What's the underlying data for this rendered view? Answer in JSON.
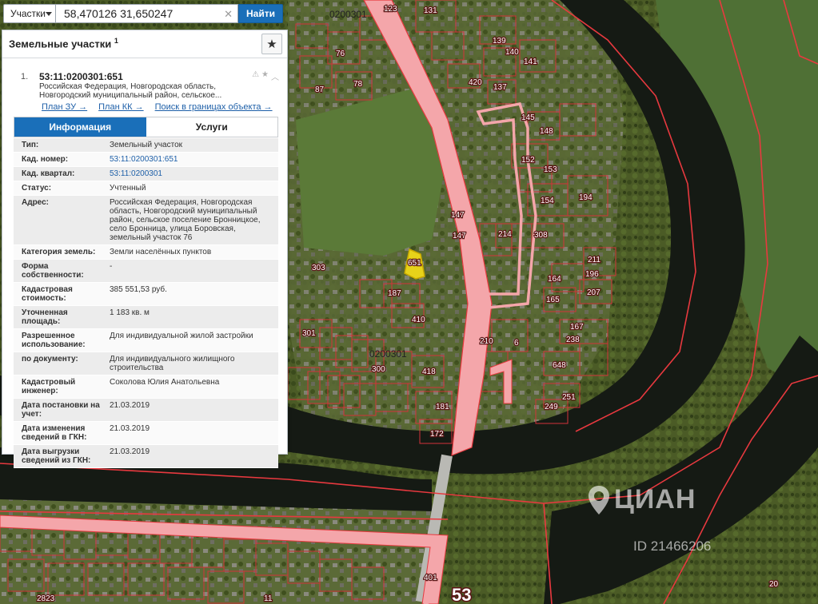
{
  "search": {
    "layer_label": "Участки",
    "coordinates_value": "58,470126 31,650247",
    "find_label": "Найти",
    "clear_symbol": "✕"
  },
  "panel": {
    "title": "Земельные участки",
    "title_sup": "1",
    "favorite_icon": "star-icon",
    "result": {
      "number": "1.",
      "cadastral_id": "53:11:0200301:651",
      "address_line1": "Российская Федерация, Новгородская область,",
      "address_line2": "Новгородский муниципальный район, сельское..."
    },
    "links": [
      "План ЗУ →",
      "План КК →",
      "Поиск в границах объекта →"
    ],
    "tabs": [
      "Информация",
      "Услуги"
    ],
    "info_rows": [
      {
        "k": "Тип:",
        "v": "Земельный участок"
      },
      {
        "k": "Кад. номер:",
        "v": "53:11:0200301:651"
      },
      {
        "k": "Кад. квартал:",
        "v": "53:11:0200301"
      },
      {
        "k": "Статус:",
        "v": "Учтенный"
      },
      {
        "k": "Адрес:",
        "v": "Российская Федерация, Новгородская область, Новгородский муниципальный район, сельское поселение Бронницкое, село Бронница, улица Боровская, земельный участок 76"
      },
      {
        "k": "Категория земель:",
        "v": "Земли населённых пунктов"
      },
      {
        "k": "Форма собственности:",
        "v": "-"
      },
      {
        "k": "Кадастровая стоимость:",
        "v": "385 551,53 руб."
      },
      {
        "k": "Уточненная площадь:",
        "v": "1 183 кв. м"
      },
      {
        "k": "Разрешенное использование:",
        "v": "Для индивидуальной жилой застройки"
      },
      {
        "k": "по документу:",
        "v": "Для индивидуального жилищного строительства"
      },
      {
        "k": "Кадастровый инженер:",
        "v": "Соколова Юлия Анатольевна"
      },
      {
        "k": "Дата постановки на учет:",
        "v": "21.03.2019"
      },
      {
        "k": "Дата изменения сведений в ГКН:",
        "v": "21.03.2019"
      },
      {
        "k": "Дата выгрузки сведений из ГКН:",
        "v": "21.03.2019"
      }
    ]
  },
  "map": {
    "quarter_labels": [
      "0200301",
      "0200301"
    ],
    "parcel_labels": [
      "303",
      "187",
      "410",
      "418",
      "210",
      "6",
      "147",
      "147",
      "214",
      "308",
      "194",
      "154",
      "153",
      "152",
      "148",
      "145",
      "211",
      "196",
      "164",
      "165",
      "207",
      "167",
      "238",
      "648",
      "251",
      "249",
      "137",
      "141",
      "140",
      "139",
      "420",
      "131",
      "76",
      "78",
      "87",
      "123",
      "401",
      "53",
      "11",
      "20",
      "2823",
      "651",
      "172",
      "181",
      "301",
      "300"
    ],
    "colors": {
      "road": "#f4a6aa",
      "boundary": "#e8393f",
      "river": "#161a16",
      "parcel_selected": "#e7d21a"
    }
  },
  "watermark": {
    "brand": "ЦИАН",
    "id_text": "ID 21466206"
  }
}
